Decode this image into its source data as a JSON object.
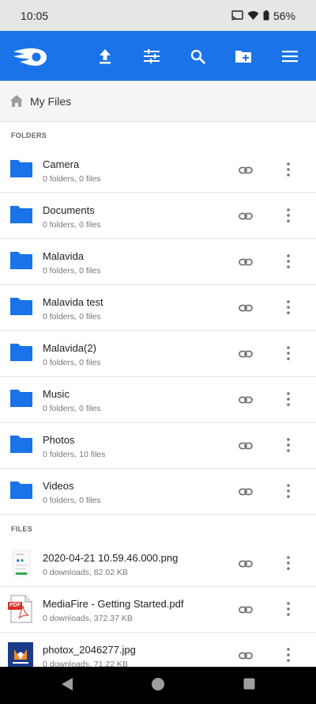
{
  "status": {
    "time": "10:05",
    "battery": "56%"
  },
  "app_bar": {
    "icons": [
      "mediafire-logo",
      "upload-icon",
      "sliders-icon",
      "search-icon",
      "new-folder-icon",
      "menu-icon"
    ],
    "color": "#1a73e8"
  },
  "breadcrumb": {
    "title": "My Files"
  },
  "sections": {
    "folders": "FOLDERS",
    "files": "FILES"
  },
  "folders": [
    {
      "name": "Camera",
      "meta": "0 folders, 0 files"
    },
    {
      "name": "Documents",
      "meta": "0 folders, 0 files"
    },
    {
      "name": "Malavida",
      "meta": "0 folders, 0 files"
    },
    {
      "name": "Malavida test",
      "meta": "0 folders, 0 files"
    },
    {
      "name": "Malavida(2)",
      "meta": "0 folders, 0 files"
    },
    {
      "name": "Music",
      "meta": "0 folders, 0 files"
    },
    {
      "name": "Photos",
      "meta": "0 folders, 10 files"
    },
    {
      "name": "Videos",
      "meta": "0 folders, 0 files"
    }
  ],
  "files": [
    {
      "name": "2020-04-21 10.59.46.000.png",
      "meta": "0 downloads, 82.02 KB",
      "icon": "image-thumbnail"
    },
    {
      "name": "MediaFire - Getting Started.pdf",
      "meta": "0 downloads, 372.37 KB",
      "icon": "pdf-icon",
      "badge": "PDF"
    },
    {
      "name": "photox_2046277.jpg",
      "meta": "0 downloads, 71.22 KB",
      "icon": "photox-thumbnail"
    }
  ],
  "colors": {
    "folder": "#1a73e8",
    "pdf": "#d93025"
  }
}
